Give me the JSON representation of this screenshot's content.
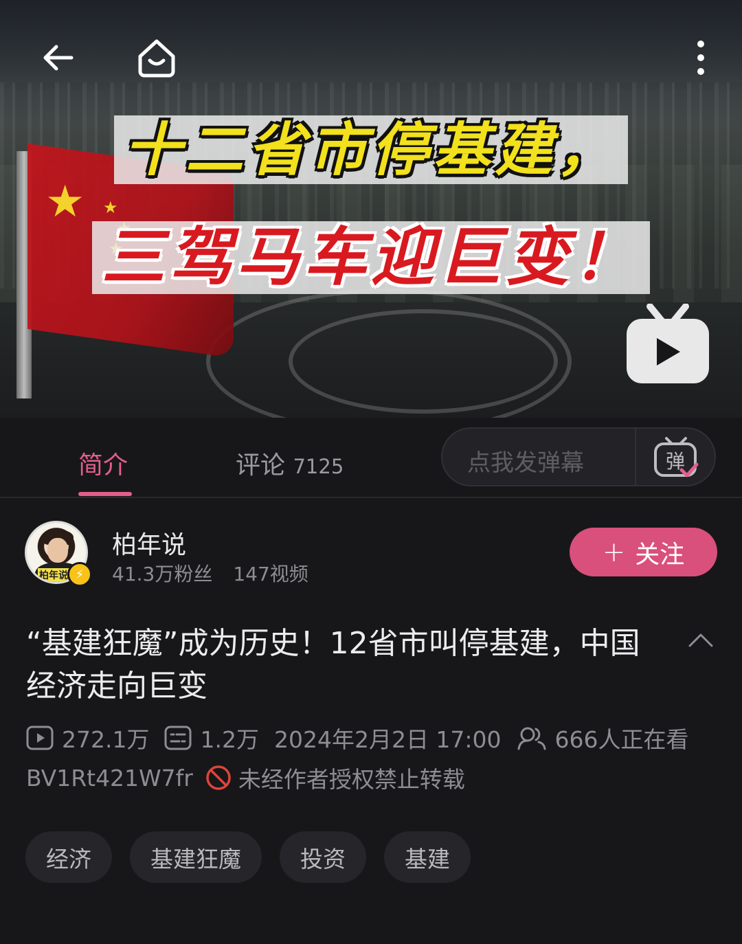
{
  "cover": {
    "title_line1": "十二省市停基建，",
    "title_line2": "三驾马车迎巨变！"
  },
  "top_bar": {
    "back_icon": "back-arrow-icon",
    "home_icon": "home-icon",
    "more_icon": "more-vertical-icon"
  },
  "tabs": [
    {
      "label": "简介",
      "count": "",
      "active": true
    },
    {
      "label": "评论",
      "count": "7125",
      "active": false
    }
  ],
  "danmaku": {
    "placeholder": "点我发弹幕",
    "button_icon": "danmaku-toggle-icon",
    "button_glyph": "弹"
  },
  "uploader": {
    "name": "柏年说",
    "followers": "41.3万粉丝",
    "videos": "147视频",
    "avatar_label": "柏年说",
    "follow_label": "关注"
  },
  "video": {
    "title": "“基建狂魔”成为历史！12省市叫停基建，中国经济走向巨变",
    "views": "272.1万",
    "danmaku_count": "1.2万",
    "publish_time": "2024年2月2日 17:00",
    "watching": "666人正在看",
    "bvid": "BV1Rt421W7fr",
    "copyright_notice": "未经作者授权禁止转载"
  },
  "tags": [
    "经济",
    "基建狂魔",
    "投资",
    "基建"
  ],
  "colors": {
    "accent": "#e25f89",
    "follow_bg": "#d9507c",
    "background": "#17171a",
    "ban_red": "#e0443a"
  }
}
